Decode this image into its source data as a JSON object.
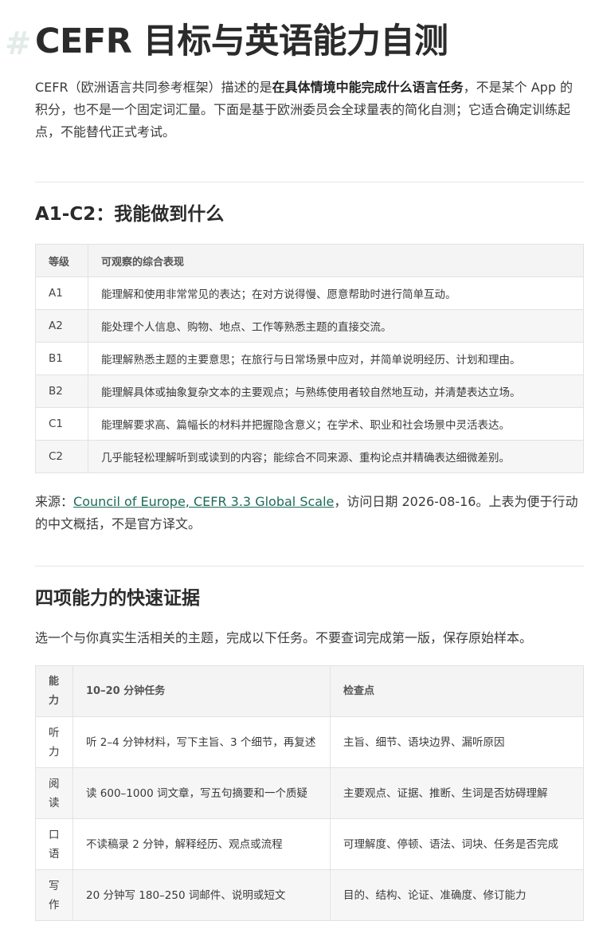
{
  "header": {
    "hash": "#",
    "title": "CEFR 目标与英语能力自测"
  },
  "intro": {
    "p1": "CEFR（欧洲语言共同参考框架）描述的是",
    "p1_bold": "在具体情境中能完成什么语言任务",
    "p1_rest": "，不是某个 App 的积分，也不是一个固定词汇量。下面是基于欧洲委员会全球量表的简化自测；它适合确定训练起点，不能替代正式考试。"
  },
  "section1": {
    "heading": "A1-C2：我能做到什么",
    "columns": [
      "等级",
      "可观察的综合表现"
    ],
    "rows": [
      {
        "level": "A1",
        "desc": "能理解和使用非常常见的表达；在对方说得慢、愿意帮助时进行简单互动。"
      },
      {
        "level": "A2",
        "desc": "能处理个人信息、购物、地点、工作等熟悉主题的直接交流。"
      },
      {
        "level": "B1",
        "desc": "能理解熟悉主题的主要意思；在旅行与日常场景中应对，并简单说明经历、计划和理由。"
      },
      {
        "level": "B2",
        "desc": "能理解具体或抽象复杂文本的主要观点；与熟练使用者较自然地互动，并清楚表达立场。"
      },
      {
        "level": "C1",
        "desc": "能理解要求高、篇幅长的材料并把握隐含意义；在学术、职业和社会场景中灵活表达。"
      },
      {
        "level": "C2",
        "desc": "几乎能轻松理解听到或读到的内容；能综合不同来源、重构论点并精确表达细微差别。"
      }
    ],
    "source_prefix": "来源：",
    "source_link": "Council of Europe, CEFR 3.3 Global Scale",
    "source_suffix": "，访问日期 2026-08-16。上表为便于行动的中文概括，不是官方译文。"
  },
  "section2": {
    "heading": "四项能力的快速证据",
    "intro": "选一个与你真实生活相关的主题，完成以下任务。不要查词完成第一版，保存原始样本。",
    "columns": [
      "能力",
      "10–20 分钟任务",
      "检查点"
    ],
    "rows": [
      {
        "skill": "听力",
        "task": "听 2–4 分钟材料，写下主旨、3 个细节，再复述",
        "check": "主旨、细节、语块边界、漏听原因"
      },
      {
        "skill": "阅读",
        "task": "读 600–1000 词文章，写五句摘要和一个质疑",
        "check": "主要观点、证据、推断、生词是否妨碍理解"
      },
      {
        "skill": "口语",
        "task": "不读稿录 2 分钟，解释经历、观点或流程",
        "check": "可理解度、停顿、语法、词块、任务是否完成"
      },
      {
        "skill": "写作",
        "task": "20 分钟写 180–250 词邮件、说明或短文",
        "check": "目的、结构、论证、准确度、修订能力"
      }
    ]
  }
}
